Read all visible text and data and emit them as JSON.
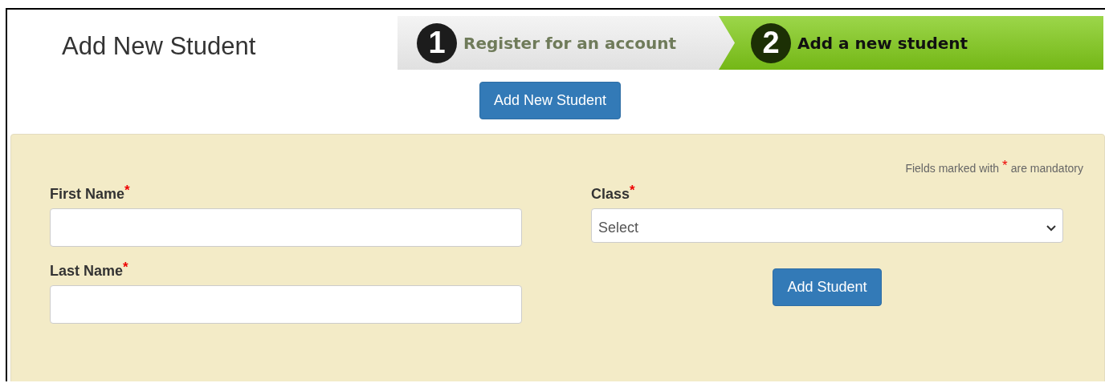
{
  "page_title": "Add New Student",
  "steps": [
    {
      "number": "1",
      "label": "Register for an account",
      "selected": false
    },
    {
      "number": "2",
      "label": "Add a new student",
      "selected": true
    }
  ],
  "add_new_button": "Add New Student",
  "form": {
    "note_before": "Fields marked with",
    "note_mark": "*",
    "note_after": "are mandatory",
    "left_fields": [
      {
        "label": "First Name",
        "mark": "*",
        "kind": "text"
      },
      {
        "label": "Last Name",
        "mark": "*",
        "kind": "text"
      }
    ],
    "right_fields": [
      {
        "label": "Class",
        "mark": "*",
        "kind": "select",
        "value": "Select"
      }
    ],
    "submit": "Add Student"
  }
}
